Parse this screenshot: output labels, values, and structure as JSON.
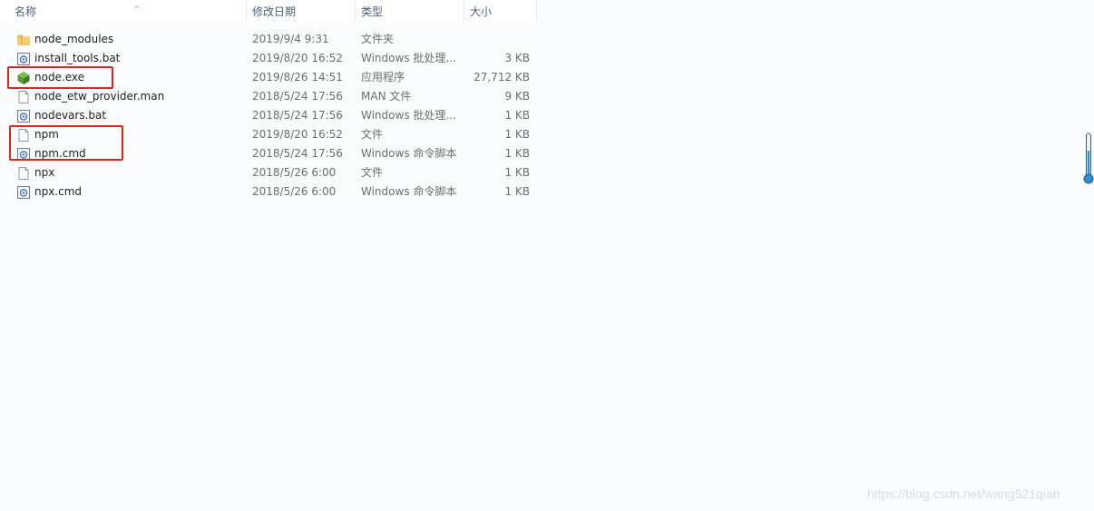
{
  "columns": {
    "name": "名称",
    "date": "修改日期",
    "type": "类型",
    "size": "大小"
  },
  "files": [
    {
      "name": "node_modules",
      "date": "2019/9/4 9:31",
      "type": "文件夹",
      "size": "",
      "icon": "folder-icon"
    },
    {
      "name": "install_tools.bat",
      "date": "2019/8/20 16:52",
      "type": "Windows 批处理...",
      "size": "3 KB",
      "icon": "batch-file-icon"
    },
    {
      "name": "node.exe",
      "date": "2019/8/26 14:51",
      "type": "应用程序",
      "size": "27,712 KB",
      "icon": "nodejs-exe-icon"
    },
    {
      "name": "node_etw_provider.man",
      "date": "2018/5/24 17:56",
      "type": "MAN 文件",
      "size": "9 KB",
      "icon": "blank-file-icon"
    },
    {
      "name": "nodevars.bat",
      "date": "2018/5/24 17:56",
      "type": "Windows 批处理...",
      "size": "1 KB",
      "icon": "batch-file-icon"
    },
    {
      "name": "npm",
      "date": "2019/8/20 16:52",
      "type": "文件",
      "size": "1 KB",
      "icon": "blank-file-icon"
    },
    {
      "name": "npm.cmd",
      "date": "2018/5/24 17:56",
      "type": "Windows 命令脚本",
      "size": "1 KB",
      "icon": "batch-file-icon"
    },
    {
      "name": "npx",
      "date": "2018/5/26 6:00",
      "type": "文件",
      "size": "1 KB",
      "icon": "blank-file-icon"
    },
    {
      "name": "npx.cmd",
      "date": "2018/5/26 6:00",
      "type": "Windows 命令脚本",
      "size": "1 KB",
      "icon": "batch-file-icon"
    }
  ],
  "watermark": "https://blog.csdn.net/wang521qian",
  "colors": {
    "highlight": "#e2231a",
    "header_text": "#4c607a",
    "folder": "#e8b54a",
    "node_green": "#5a9e3a",
    "thermometer": "#2b8fd6"
  }
}
